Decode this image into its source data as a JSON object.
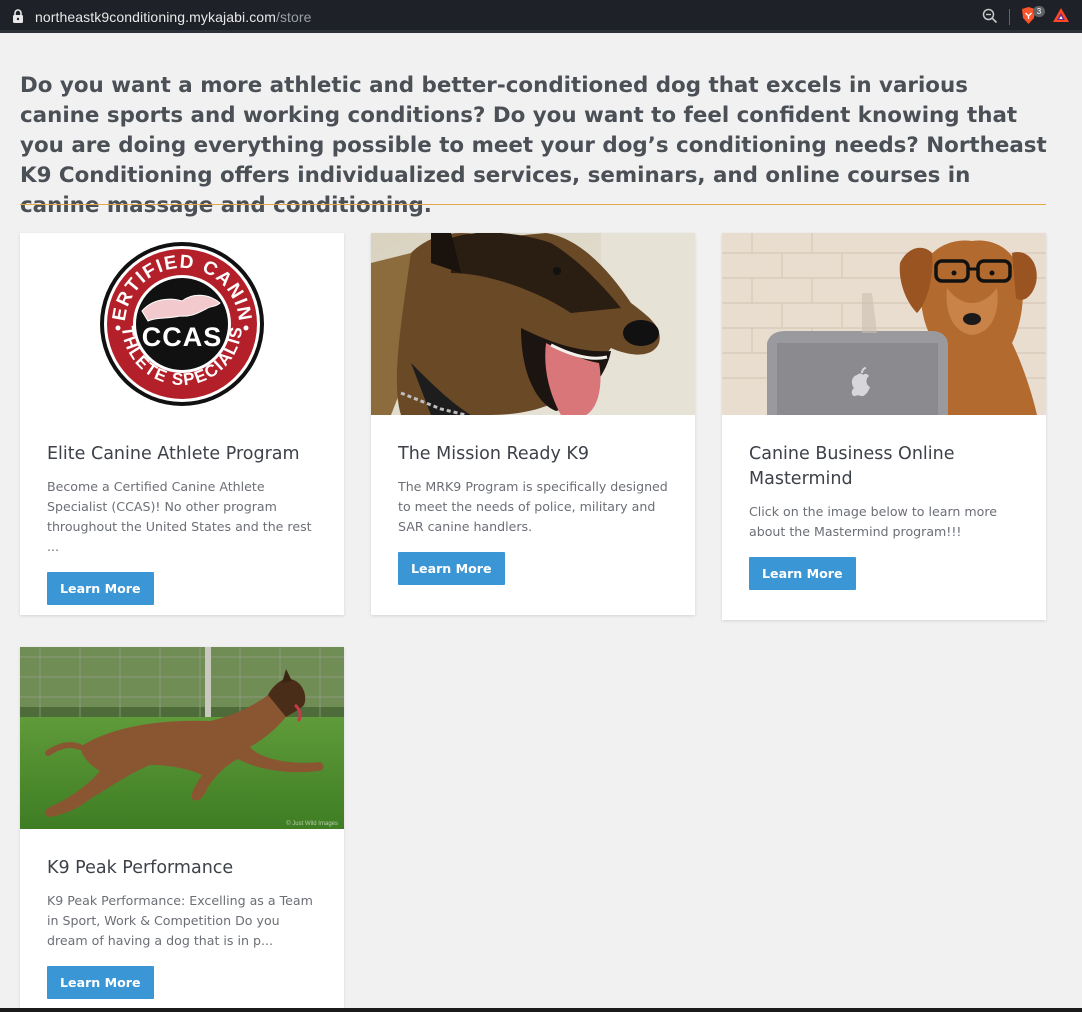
{
  "browser": {
    "url_domain": "northeastk9conditioning.mykajabi.com",
    "url_path": "/store",
    "shield_count": "3"
  },
  "hero": {
    "text": "Do you want a more athletic and better-conditioned dog that excels in various canine sports and working conditions? Do you want to feel confident knowing that you are doing everything possible to meet your dog’s conditioning needs? Northeast K9 Conditioning offers individualized services, seminars, and online courses in canine massage and conditioning."
  },
  "products": [
    {
      "title": "Elite Canine Athlete Program",
      "description": "Become a Certified Canine Athlete Specialist (CCAS)! No other program throughout the United States and the rest ...",
      "button": "Learn More",
      "logo": {
        "top_text": "CERTIFIED CANINE",
        "center_text": "CCAS",
        "bottom_text": "ATHLETE SPECIALIST"
      }
    },
    {
      "title": "The Mission Ready K9",
      "description": "The MRK9 Program is specifically designed to meet the needs of police, military and SAR canine handlers.",
      "button": "Learn More"
    },
    {
      "title": "Canine Business Online Mastermind",
      "description": "Click on the image below to learn more about the Mastermind program!!!",
      "button": "Learn More"
    },
    {
      "title": "K9 Peak Performance",
      "description": "K9 Peak Performance: Excelling as a Team in Sport, Work & Competition Do you dream of having a dog that is in p...",
      "button": "Learn More"
    }
  ],
  "colors": {
    "accent_divider": "#e3a84b",
    "button": "#3b96d6",
    "logo_red": "#b3202a"
  }
}
